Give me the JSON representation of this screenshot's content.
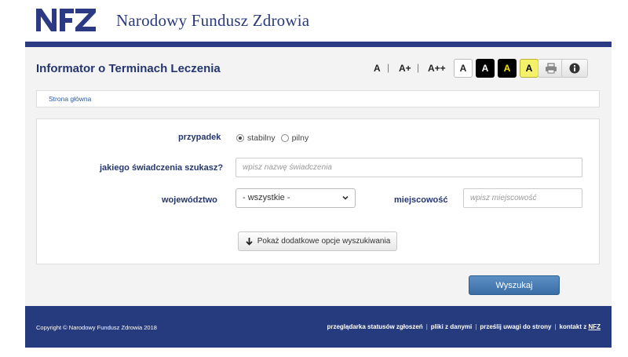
{
  "brand": {
    "logo_text": "NFZ",
    "name": "Narodowy Fundusz Zdrowia"
  },
  "header": {
    "title": "Informator o Terminach Leczenia",
    "font_sizes": [
      "A",
      "A+",
      "A++"
    ],
    "separator": "|",
    "contrast_buttons": [
      "A",
      "A",
      "A",
      "A"
    ],
    "print_icon": "printer-icon",
    "info_icon": "info-icon"
  },
  "breadcrumb": {
    "home": "Strona główna"
  },
  "form": {
    "case_label": "przypadek",
    "case_options": [
      "stabilny",
      "pilny"
    ],
    "case_selected": "stabilny",
    "service_label": "jakiego świadczenia szukasz?",
    "service_placeholder": "wpisz nazwę świadczenia",
    "service_value": "",
    "province_label": "województwo",
    "province_value": "- wszystkie -",
    "city_label": "miejscowość",
    "city_placeholder": "wpisz miejscowość",
    "city_value": "",
    "more_options": "Pokaż dodatkowe opcje wyszukiwania",
    "search": "Wyszukaj"
  },
  "footer": {
    "copyright": "Copyright © Narodowy Fundusz Zdrowia 2018",
    "links": [
      "przeglądarka statusów zgłoszeń",
      "pliki z danymi",
      "prześlij uwagi do strony",
      "kontakt z"
    ],
    "nfz_link": "NFZ",
    "separator": "|"
  },
  "colors": {
    "brand_blue": "#2b3a82",
    "title_blue": "#25366f",
    "button_blue": "#3a6ea5",
    "contrast_yellow": "#f5f069"
  }
}
